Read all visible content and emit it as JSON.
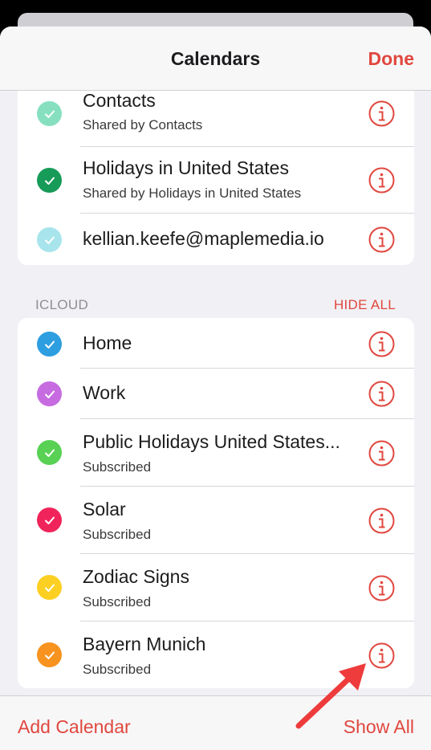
{
  "nav": {
    "title": "Calendars",
    "done_label": "Done"
  },
  "other_calendars": [
    {
      "title": "Contacts",
      "subtitle": "Shared by Contacts",
      "color": "#86e0c0"
    },
    {
      "title": "Holidays in United States",
      "subtitle": "Shared by Holidays in United States",
      "color": "#179b58"
    },
    {
      "title": "kellian.keefe@maplemedia.io",
      "subtitle": "",
      "color": "#a8e4ec"
    }
  ],
  "icloud": {
    "header": "ICLOUD",
    "hide_all_label": "HIDE ALL",
    "calendars": [
      {
        "title": "Home",
        "subtitle": "",
        "color": "#2d9ee0"
      },
      {
        "title": "Work",
        "subtitle": "",
        "color": "#c66ce0"
      },
      {
        "title": "Public Holidays United States...",
        "subtitle": "Subscribed",
        "color": "#58d154"
      },
      {
        "title": "Solar",
        "subtitle": "Subscribed",
        "color": "#f0245a"
      },
      {
        "title": "Zodiac Signs",
        "subtitle": "Subscribed",
        "color": "#fcd022"
      },
      {
        "title": "Bayern Munich",
        "subtitle": "Subscribed",
        "color": "#f7931e"
      }
    ]
  },
  "toolbar": {
    "add_label": "Add Calendar",
    "show_all_label": "Show All"
  },
  "accent_color": "#e0473e"
}
